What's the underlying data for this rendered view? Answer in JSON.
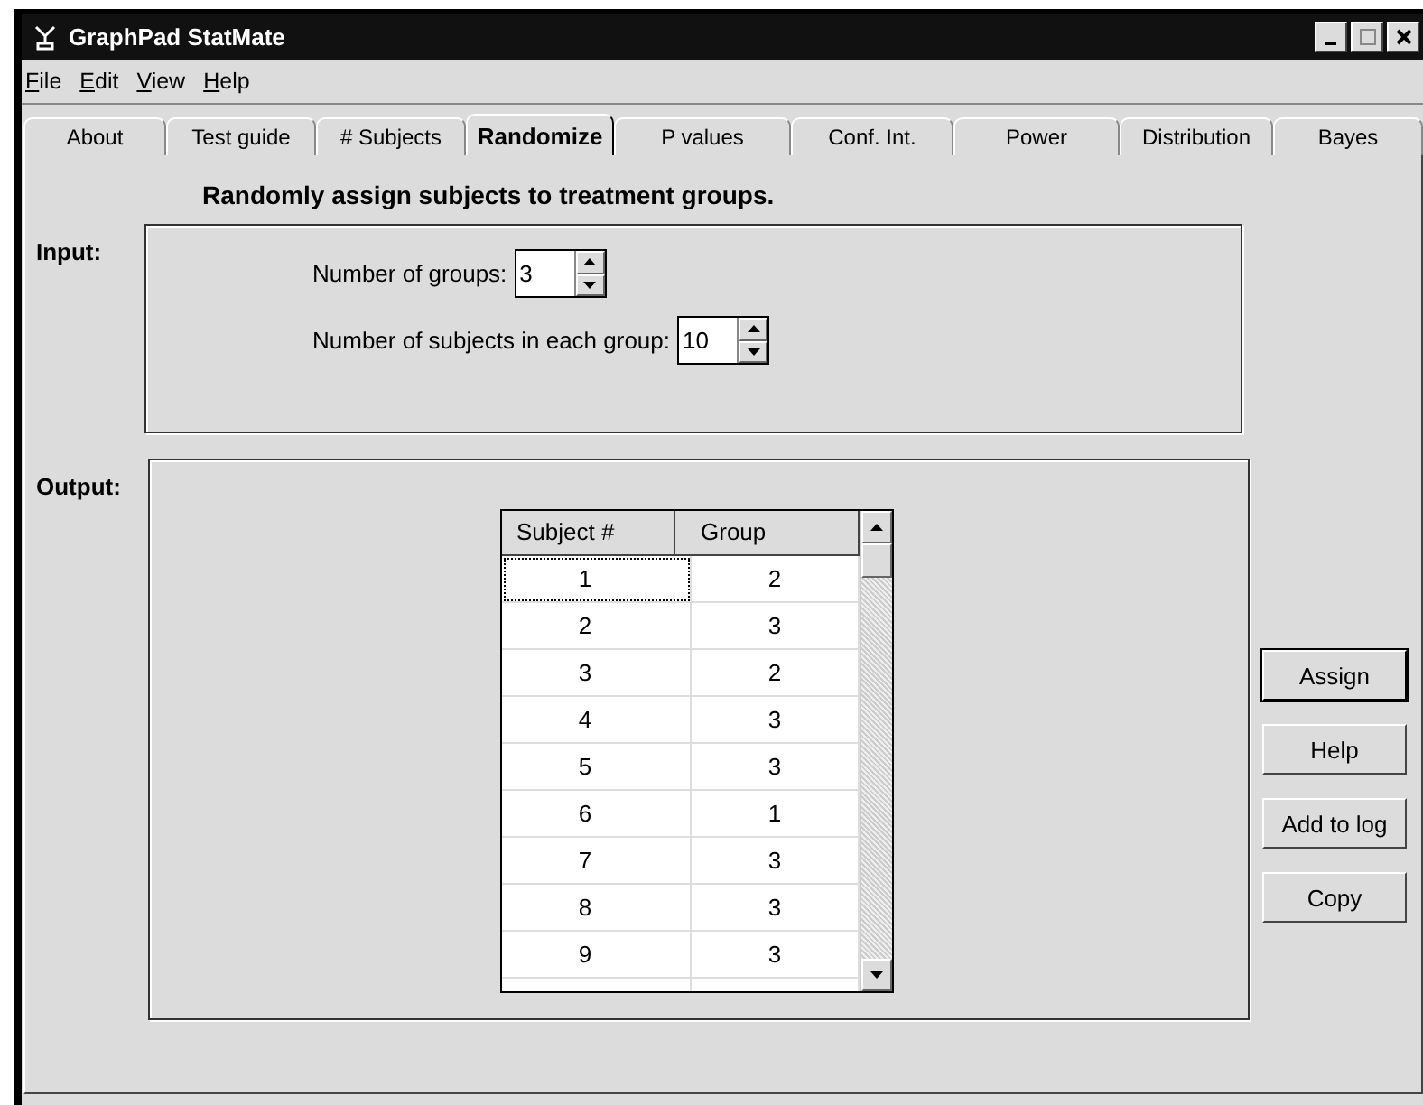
{
  "window": {
    "title": "GraphPad StatMate"
  },
  "menu": [
    {
      "label": "File"
    },
    {
      "label": "Edit"
    },
    {
      "label": "View"
    },
    {
      "label": "Help"
    }
  ],
  "tabs": [
    {
      "label": "About",
      "selected": false
    },
    {
      "label": "Test guide",
      "selected": false
    },
    {
      "label": "# Subjects",
      "selected": false
    },
    {
      "label": "Randomize",
      "selected": true
    },
    {
      "label": "P values",
      "selected": false
    },
    {
      "label": "Conf. Int.",
      "selected": false
    },
    {
      "label": "Power",
      "selected": false
    },
    {
      "label": "Distribution",
      "selected": false
    },
    {
      "label": "Bayes",
      "selected": false
    }
  ],
  "heading": "Randomly assign subjects to treatment groups.",
  "input": {
    "label": "Input:",
    "fields": [
      {
        "label": "Number of groups:",
        "value": "3"
      },
      {
        "label": "Number of subjects in each group:",
        "value": "10"
      }
    ]
  },
  "output": {
    "label": "Output:",
    "table": {
      "columns": [
        "Subject #",
        "Group"
      ],
      "rows": [
        [
          "1",
          "2"
        ],
        [
          "2",
          "3"
        ],
        [
          "3",
          "2"
        ],
        [
          "4",
          "3"
        ],
        [
          "5",
          "3"
        ],
        [
          "6",
          "1"
        ],
        [
          "7",
          "3"
        ],
        [
          "8",
          "3"
        ],
        [
          "9",
          "3"
        ]
      ]
    }
  },
  "buttons": [
    {
      "label": "Assign",
      "default": true
    },
    {
      "label": "Help",
      "default": false
    },
    {
      "label": "Add to log",
      "default": false
    },
    {
      "label": "Copy",
      "default": false
    }
  ]
}
